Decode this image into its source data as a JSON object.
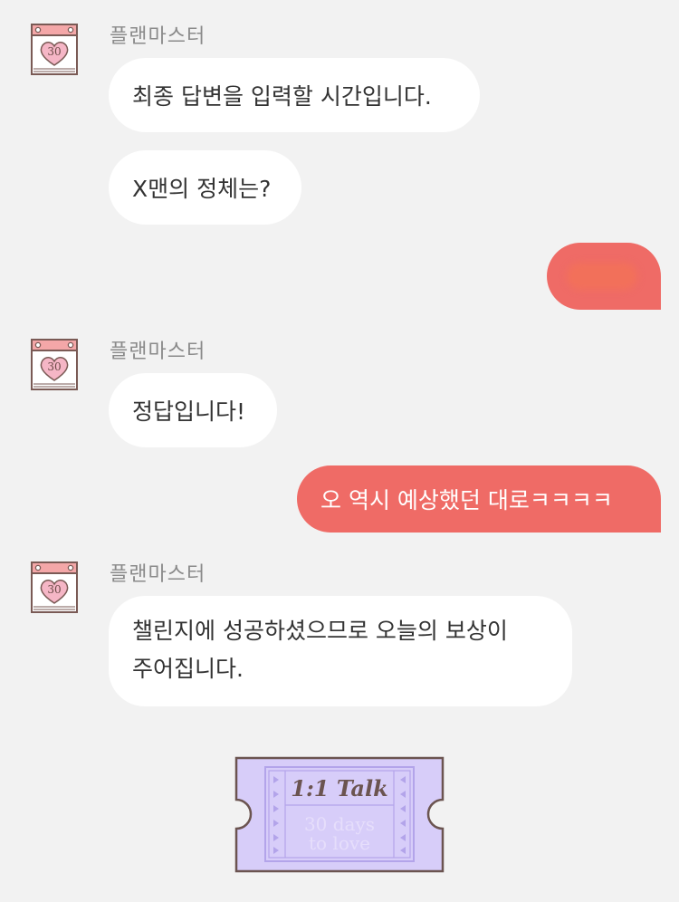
{
  "colors": {
    "background": "#f2f2f2",
    "incoming_bubble": "#ffffff",
    "outgoing_bubble": "#ef6b66",
    "ticket_fill": "#d7cdf9"
  },
  "messages": [
    {
      "type": "sender",
      "name": "플랜마스터"
    },
    {
      "type": "incoming",
      "text": "최종 답변을 입력할 시간입니다."
    },
    {
      "type": "incoming",
      "text": "X맨의 정체는?"
    },
    {
      "type": "outgoing_redacted"
    },
    {
      "type": "sender",
      "name": "플랜마스터"
    },
    {
      "type": "incoming",
      "text": "정답입니다!"
    },
    {
      "type": "outgoing",
      "text": "오 역시 예상했던 대로ㅋㅋㅋㅋ"
    },
    {
      "type": "sender",
      "name": "플랜마스터"
    },
    {
      "type": "incoming",
      "line1": "챌린지에 성공하셨으므로 오늘의 보상이",
      "line2": "주어집니다."
    }
  ],
  "avatar": {
    "icon": "calendar-heart-icon",
    "day": "30"
  },
  "reward_ticket": {
    "icon": "ticket-icon",
    "title": "1:1 Talk",
    "subtitle_line1": "30 days",
    "subtitle_line2": "to love"
  }
}
